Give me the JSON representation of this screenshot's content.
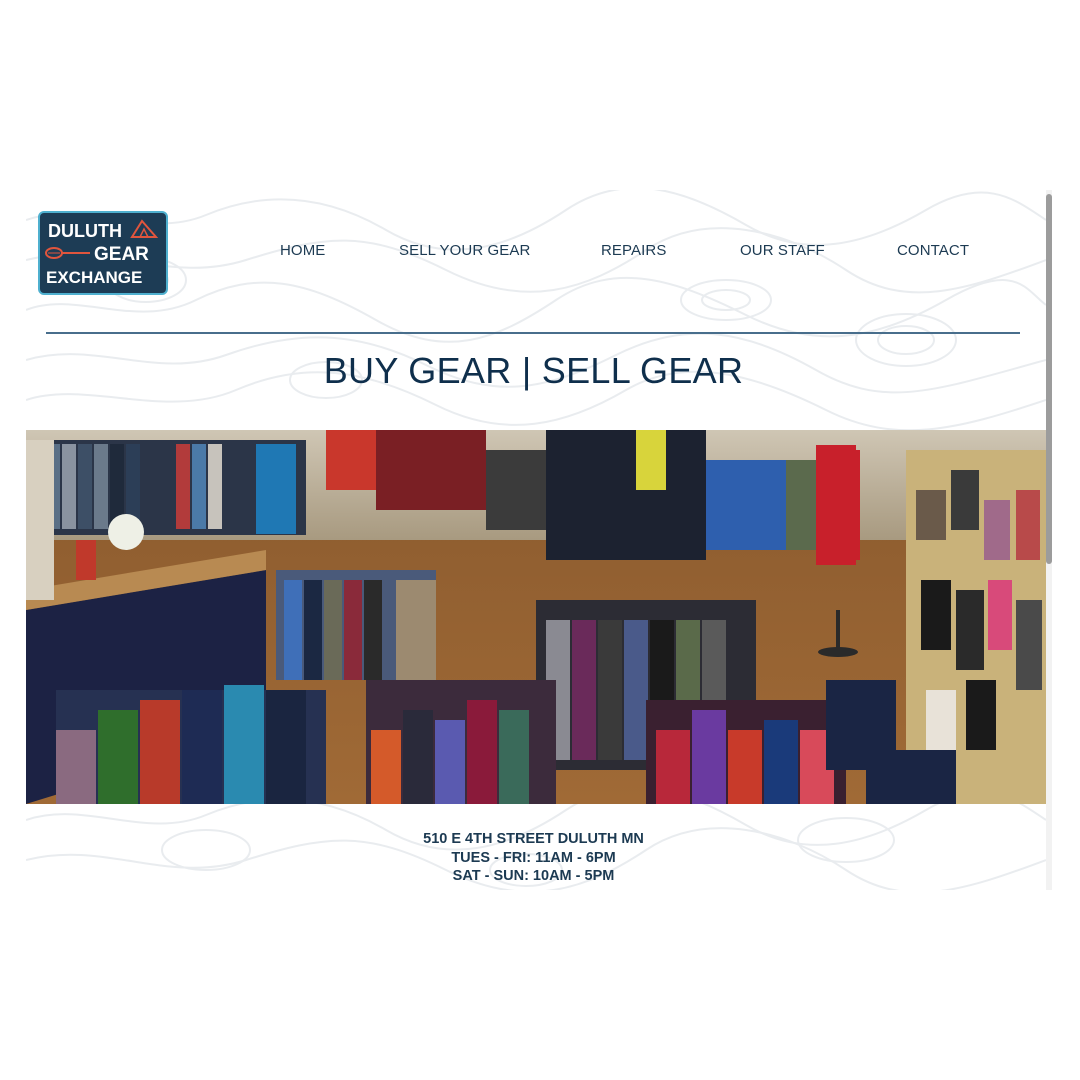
{
  "brand": {
    "logo_line1": "DULUTH",
    "logo_line2": "GEAR",
    "logo_line3": "EXCHANGE",
    "colors": {
      "navy": "#1d3c55",
      "teal_border": "#4fb0cf",
      "accent_red": "#e0553d",
      "text": "#0f2f4c"
    }
  },
  "nav": {
    "items": [
      {
        "label": "HOME"
      },
      {
        "label": "SELL YOUR GEAR"
      },
      {
        "label": "REPAIRS"
      },
      {
        "label": "OUR STAFF"
      },
      {
        "label": "CONTACT"
      }
    ]
  },
  "hero": {
    "tagline": "BUY GEAR | SELL GEAR",
    "photo_icon": "store-interior-photo"
  },
  "info": {
    "address": "510 E 4TH STREET DULUTH MN",
    "hours_weekday": "TUES - FRI: 11AM - 6PM",
    "hours_weekend": "SAT - SUN: 10AM - 5PM"
  }
}
